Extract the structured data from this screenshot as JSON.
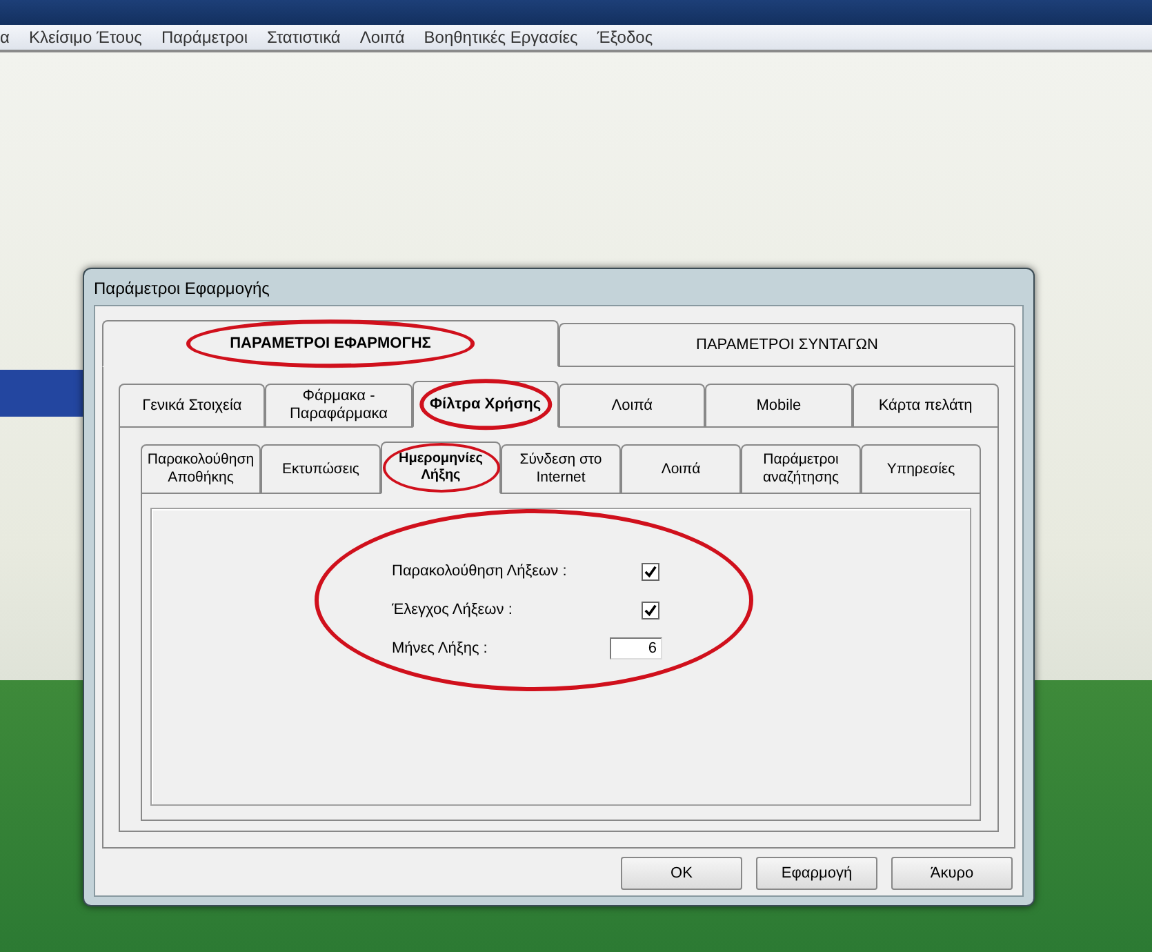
{
  "menu": [
    {
      "label": "α"
    },
    {
      "label": "Κλείσιμο Έτους"
    },
    {
      "label": "Παράμετροι"
    },
    {
      "label": "Στατιστικά"
    },
    {
      "label": "Λοιπά"
    },
    {
      "label": "Βοηθητικές Εργασίες"
    },
    {
      "label": "Έξοδος"
    }
  ],
  "dialog": {
    "title": "Παράμετροι Εφαρμογής",
    "tabs": [
      {
        "label": "ΠΑΡΑΜΕΤΡΟΙ ΕΦΑΡΜΟΓΗΣ",
        "selected": true,
        "circled": true
      },
      {
        "label": "ΠΑΡΑΜΕΤΡΟΙ ΣΥΝΤΑΓΩΝ",
        "selected": false,
        "circled": false
      }
    ],
    "subtabs": [
      {
        "label": "Γενικά Στοιχεία",
        "selected": false,
        "circled": false
      },
      {
        "label": "Φάρμακα - Παραφάρμακα",
        "selected": false,
        "circled": false
      },
      {
        "label": "Φίλτρα Χρήσης",
        "selected": true,
        "circled": true
      },
      {
        "label": "Λοιπά",
        "selected": false,
        "circled": false
      },
      {
        "label": "Mobile",
        "selected": false,
        "circled": false
      },
      {
        "label": "Κάρτα πελάτη",
        "selected": false,
        "circled": false
      }
    ],
    "pages": [
      {
        "label": "Παρακολούθηση Αποθήκης",
        "selected": false,
        "circled": false
      },
      {
        "label": "Εκτυπώσεις",
        "selected": false,
        "circled": false
      },
      {
        "label": "Ημερομηνίες Λήξης",
        "selected": true,
        "circled": true
      },
      {
        "label": "Σύνδεση στο Internet",
        "selected": false,
        "circled": false
      },
      {
        "label": "Λοιπά",
        "selected": false,
        "circled": false
      },
      {
        "label": "Παράμετροι αναζήτησης",
        "selected": false,
        "circled": false
      },
      {
        "label": "Υπηρεσίες",
        "selected": false,
        "circled": false
      }
    ],
    "fields_circled": true,
    "fields": [
      {
        "kind": "checkbox",
        "label": "Παρακολούθηση Λήξεων :",
        "checked": true
      },
      {
        "kind": "checkbox",
        "label": "Έλεγχος Λήξεων :",
        "checked": true
      },
      {
        "kind": "number",
        "label": "Μήνες Λήξης :",
        "value": "6"
      }
    ],
    "buttons": [
      {
        "label": "OK"
      },
      {
        "label": "Εφαρμογή"
      },
      {
        "label": "Άκυρο"
      }
    ]
  }
}
